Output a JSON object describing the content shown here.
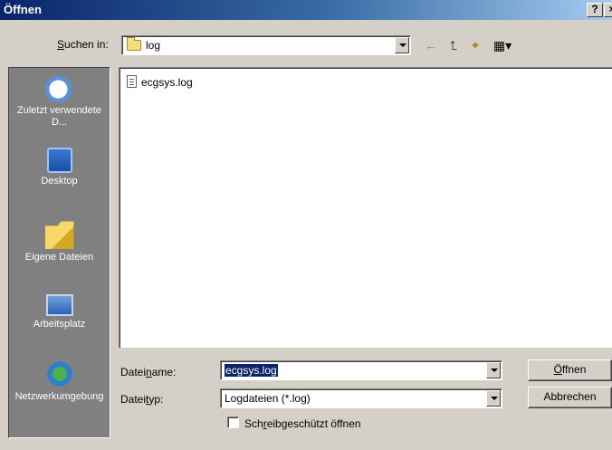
{
  "window": {
    "title": "Öffnen",
    "help_btn": "?",
    "close_btn": "×"
  },
  "lookin": {
    "label_pre": "",
    "label_accel": "S",
    "label_post": "uchen in:",
    "value": "log"
  },
  "toolbar": {
    "back": "←",
    "up": "⮤",
    "new_folder": "✦",
    "view": "▦▾"
  },
  "places": [
    {
      "label": "Zuletzt verwendete D...",
      "icon": "recent-documents-icon"
    },
    {
      "label": "Desktop",
      "icon": "desktop-icon"
    },
    {
      "label": "Eigene Dateien",
      "icon": "my-documents-icon"
    },
    {
      "label": "Arbeitsplatz",
      "icon": "my-computer-icon"
    },
    {
      "label": "Netzwerkumgebung",
      "icon": "network-places-icon"
    }
  ],
  "files": [
    {
      "name": "ecgsys.log",
      "icon": "text-file-icon"
    }
  ],
  "filename": {
    "label_pre": "Datei",
    "label_accel": "n",
    "label_post": "ame:",
    "value": "ecgsys.log"
  },
  "filetype": {
    "label_pre": "Datei",
    "label_accel": "t",
    "label_post": "yp:",
    "value": "Logdateien (*.log)"
  },
  "readonly": {
    "label_pre": "Sch",
    "label_accel": "r",
    "label_post": "eibgeschützt öffnen",
    "checked": false
  },
  "buttons": {
    "open_accel": "Ö",
    "open_rest": "ffnen",
    "cancel": "Abbrechen"
  },
  "colors": {
    "titlebar": "#0a246a",
    "face": "#d4d0c8",
    "places_bg": "#808080",
    "selection": "#0a246a"
  }
}
